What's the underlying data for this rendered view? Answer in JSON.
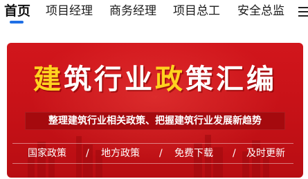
{
  "tabs": [
    {
      "label": "首页"
    },
    {
      "label": "项目经理"
    },
    {
      "label": "商务经理"
    },
    {
      "label": "项目总工"
    },
    {
      "label": "安全总监"
    }
  ],
  "banner": {
    "title_parts": [
      "建",
      "筑行业",
      "政",
      "策汇编"
    ],
    "subtitle": "整理建筑行业相关政策、把握建筑行业发展新趋势",
    "links": [
      {
        "label": "国家政策"
      },
      {
        "label": "地方政策"
      },
      {
        "label": "免费下载"
      },
      {
        "label": "及时更新"
      }
    ],
    "separator": "/"
  },
  "colors": {
    "accent": "#1f6fe5",
    "banner_red": "#c51117",
    "title_gold": "#ffd21f"
  }
}
